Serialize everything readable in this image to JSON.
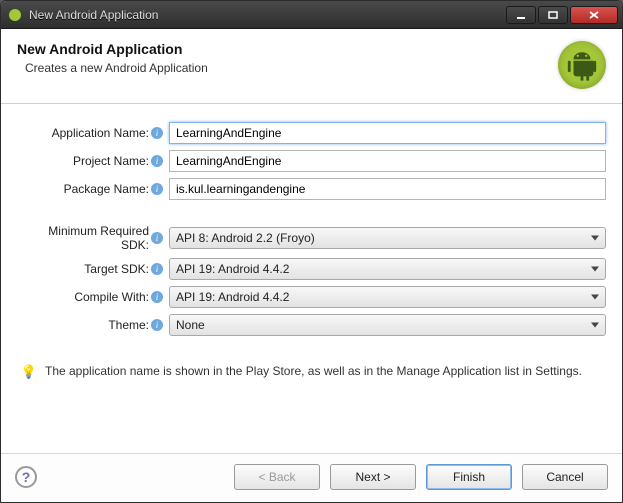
{
  "window": {
    "title": "New Android Application"
  },
  "header": {
    "title": "New Android Application",
    "subtitle": "Creates a new Android Application"
  },
  "form": {
    "applicationName": {
      "label": "Application Name:",
      "value": "LearningAndEngine"
    },
    "projectName": {
      "label": "Project Name:",
      "value": "LearningAndEngine"
    },
    "packageName": {
      "label": "Package Name:",
      "value": "is.kul.learningandengine"
    },
    "minSdk": {
      "label": "Minimum Required SDK:",
      "value": "API 8: Android 2.2 (Froyo)"
    },
    "targetSdk": {
      "label": "Target SDK:",
      "value": "API 19: Android 4.4.2"
    },
    "compileWith": {
      "label": "Compile With:",
      "value": "API 19: Android 4.4.2"
    },
    "theme": {
      "label": "Theme:",
      "value": "None"
    }
  },
  "tip": "The application name is shown in the Play Store, as well as in the Manage Application list in Settings.",
  "buttons": {
    "back": "< Back",
    "next": "Next >",
    "finish": "Finish",
    "cancel": "Cancel"
  }
}
